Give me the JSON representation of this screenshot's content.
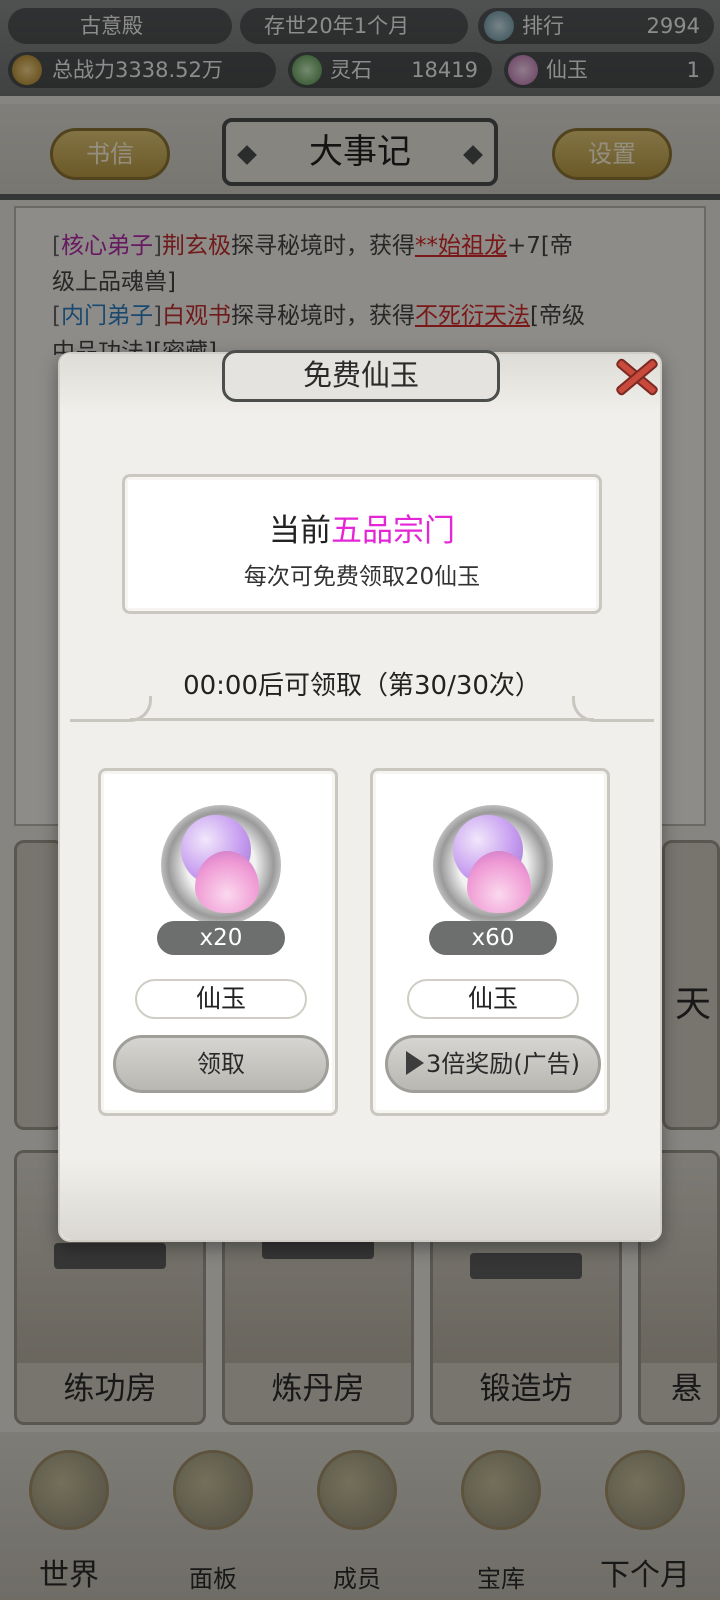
{
  "topbar": {
    "sect_name": "古意殿",
    "era": "存世20年1个月",
    "rank_label": "排行",
    "rank_value": "2994",
    "power": "总战力3338.52万",
    "spirit_stone_label": "灵石",
    "spirit_stone_value": "18419",
    "jade_label": "仙玉",
    "jade_value": "1"
  },
  "annals": {
    "letters_button": "书信",
    "title": "大事记",
    "settings_button": "设置",
    "entries": [
      {
        "tag": "核心弟子",
        "name": "荆玄极",
        "action": "探寻秘境时，获得",
        "item": "**始祖龙",
        "suffix": "+7[帝",
        "line2": "级上品魂兽]"
      },
      {
        "tag": "内门弟子",
        "name": "白观书",
        "action": "探寻秘境时，获得",
        "item": "不死衍天法",
        "suffix": "[帝级",
        "line2": "中品功法][密藏]"
      }
    ]
  },
  "buildings": [
    {
      "label": "练功房"
    },
    {
      "label": "炼丹房"
    },
    {
      "label": "锻造坊"
    },
    {
      "label": "悬"
    }
  ],
  "side_text": "天",
  "bottom_nav": [
    {
      "label": "世界",
      "icon": "world-icon"
    },
    {
      "label": "面板",
      "icon": "panel-icon"
    },
    {
      "label": "成员",
      "icon": "members-icon"
    },
    {
      "label": "宝库",
      "icon": "treasury-icon"
    },
    {
      "label": "下个月",
      "icon": "next-month-icon"
    }
  ],
  "modal": {
    "title": "免费仙玉",
    "info_prefix": "当前",
    "sect_rank": "五品宗门",
    "info_desc": "每次可免费领取20仙玉",
    "timer_text": "00:00后可领取（第30/30次）",
    "cards": [
      {
        "qty": "x20",
        "name": "仙玉",
        "button": "领取",
        "icon": "immortal-jade-icon"
      },
      {
        "qty": "x60",
        "name": "仙玉",
        "button": "3倍奖励(广告)",
        "icon": "immortal-jade-icon"
      }
    ]
  },
  "colors": {
    "highlight_magenta": "#e426d6",
    "core_disciple": "#b02ba8",
    "inner_disciple": "#2d7ec1",
    "reward_item": "#d22a2a"
  }
}
